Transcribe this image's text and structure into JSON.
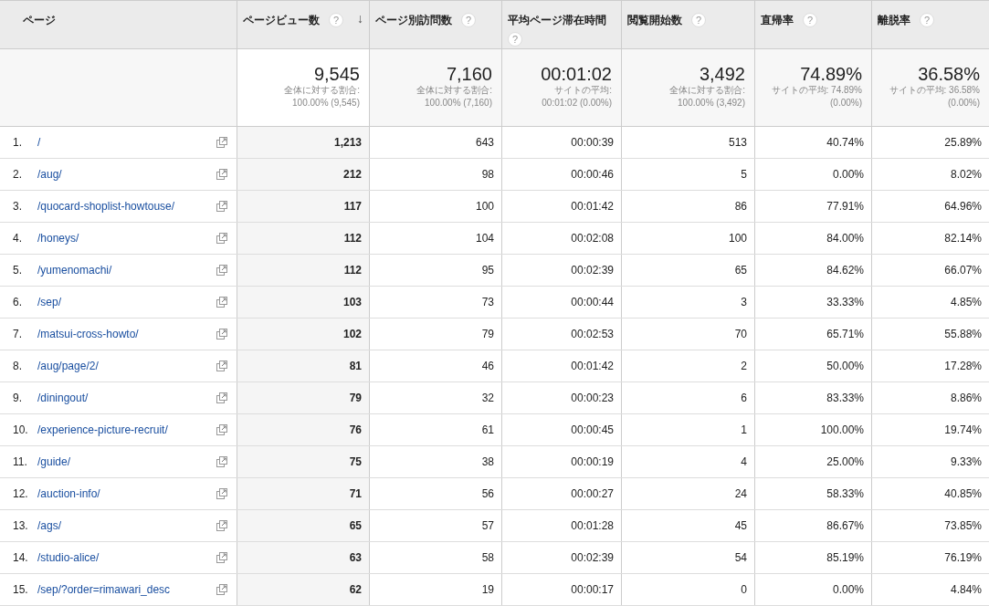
{
  "columns": [
    {
      "label": "ページ"
    },
    {
      "label": "ページビュー数",
      "help": "?",
      "sort_arrow": "↓"
    },
    {
      "label": "ページ別訪問数",
      "help": "?"
    },
    {
      "label": "平均ページ滞在時間",
      "help": "?"
    },
    {
      "label": "閲覧開始数",
      "help": "?"
    },
    {
      "label": "直帰率",
      "help": "?"
    },
    {
      "label": "離脱率",
      "help": "?"
    }
  ],
  "summary": [
    {
      "value": "9,545",
      "note": [
        "全体に対する割合:",
        "100.00% (9,545)"
      ]
    },
    {
      "value": "7,160",
      "note": [
        "全体に対する割合:",
        "100.00% (7,160)"
      ]
    },
    {
      "value": "00:01:02",
      "note": [
        "サイトの平均:",
        "00:01:02 (0.00%)"
      ]
    },
    {
      "value": "3,492",
      "note": [
        "全体に対する割合:",
        "100.00% (3,492)"
      ]
    },
    {
      "value": "74.89%",
      "note": [
        "サイトの平均: 74.89%",
        "(0.00%)"
      ]
    },
    {
      "value": "36.58%",
      "note": [
        "サイトの平均: 36.58%",
        "(0.00%)"
      ]
    }
  ],
  "rows": [
    {
      "index": "1.",
      "page": "/",
      "cells": [
        "1,213",
        "643",
        "00:00:39",
        "513",
        "40.74%",
        "25.89%"
      ]
    },
    {
      "index": "2.",
      "page": "/aug/",
      "cells": [
        "212",
        "98",
        "00:00:46",
        "5",
        "0.00%",
        "8.02%"
      ]
    },
    {
      "index": "3.",
      "page": "/quocard-shoplist-howtouse/",
      "cells": [
        "117",
        "100",
        "00:01:42",
        "86",
        "77.91%",
        "64.96%"
      ]
    },
    {
      "index": "4.",
      "page": "/honeys/",
      "cells": [
        "112",
        "104",
        "00:02:08",
        "100",
        "84.00%",
        "82.14%"
      ]
    },
    {
      "index": "5.",
      "page": "/yumenomachi/",
      "cells": [
        "112",
        "95",
        "00:02:39",
        "65",
        "84.62%",
        "66.07%"
      ]
    },
    {
      "index": "6.",
      "page": "/sep/",
      "cells": [
        "103",
        "73",
        "00:00:44",
        "3",
        "33.33%",
        "4.85%"
      ]
    },
    {
      "index": "7.",
      "page": "/matsui-cross-howto/",
      "cells": [
        "102",
        "79",
        "00:02:53",
        "70",
        "65.71%",
        "55.88%"
      ]
    },
    {
      "index": "8.",
      "page": "/aug/page/2/",
      "cells": [
        "81",
        "46",
        "00:01:42",
        "2",
        "50.00%",
        "17.28%"
      ]
    },
    {
      "index": "9.",
      "page": "/diningout/",
      "cells": [
        "79",
        "32",
        "00:00:23",
        "6",
        "83.33%",
        "8.86%"
      ]
    },
    {
      "index": "10.",
      "page": "/experience-picture-recruit/",
      "cells": [
        "76",
        "61",
        "00:00:45",
        "1",
        "100.00%",
        "19.74%"
      ]
    },
    {
      "index": "11.",
      "page": "/guide/",
      "cells": [
        "75",
        "38",
        "00:00:19",
        "4",
        "25.00%",
        "9.33%"
      ]
    },
    {
      "index": "12.",
      "page": "/auction-info/",
      "cells": [
        "71",
        "56",
        "00:00:27",
        "24",
        "58.33%",
        "40.85%"
      ]
    },
    {
      "index": "13.",
      "page": "/ags/",
      "cells": [
        "65",
        "57",
        "00:01:28",
        "45",
        "86.67%",
        "73.85%"
      ]
    },
    {
      "index": "14.",
      "page": "/studio-alice/",
      "cells": [
        "63",
        "58",
        "00:02:39",
        "54",
        "85.19%",
        "76.19%"
      ]
    },
    {
      "index": "15.",
      "page": "/sep/?order=rimawari_desc",
      "cells": [
        "62",
        "19",
        "00:00:17",
        "0",
        "0.00%",
        "4.84%"
      ]
    }
  ]
}
